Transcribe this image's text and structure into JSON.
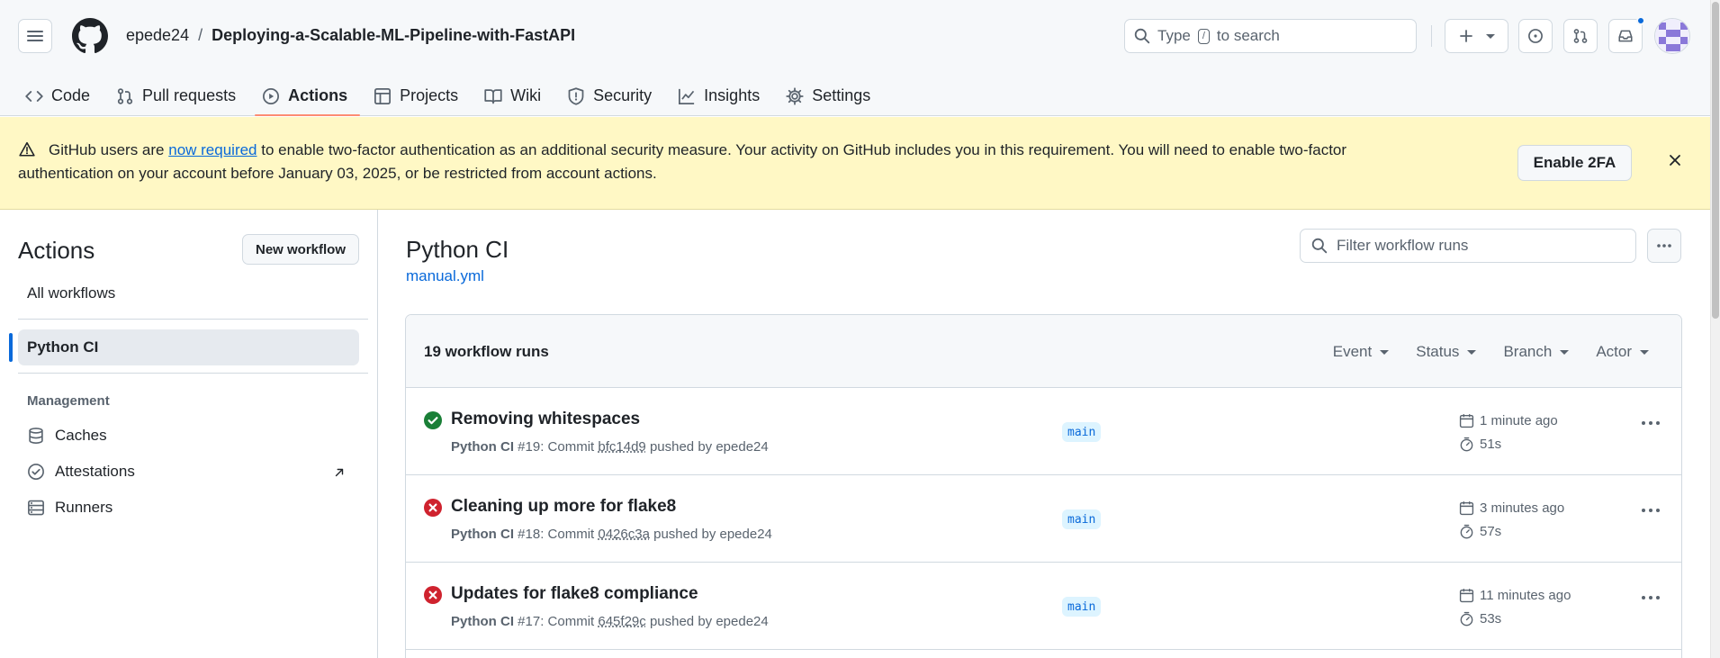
{
  "header": {
    "repo_owner": "epede24",
    "separator": "/",
    "repo_name": "Deploying-a-Scalable-ML-Pipeline-with-FastAPI",
    "search_prefix": "Type",
    "search_key": "/",
    "search_suffix": "to search"
  },
  "nav": {
    "code": "Code",
    "pull_requests": "Pull requests",
    "actions": "Actions",
    "projects": "Projects",
    "wiki": "Wiki",
    "security": "Security",
    "insights": "Insights",
    "settings": "Settings"
  },
  "banner": {
    "text_before_link": "GitHub users are ",
    "link": "now required",
    "text_after_link": " to enable two-factor authentication as an additional security measure. Your activity on GitHub includes you in this requirement. You will need to enable two-factor authentication on your account before January 03, 2025, or be restricted from account actions.",
    "button": "Enable 2FA"
  },
  "sidebar": {
    "title": "Actions",
    "new_workflow": "New workflow",
    "all_workflows": "All workflows",
    "active_workflow": "Python CI",
    "management_heading": "Management",
    "caches": "Caches",
    "attestations": "Attestations",
    "runners": "Runners"
  },
  "main": {
    "title": "Python CI",
    "file": "manual.yml",
    "filter_placeholder": "Filter workflow runs",
    "runs_count": "19 workflow runs",
    "filters": [
      "Event",
      "Status",
      "Branch",
      "Actor"
    ]
  },
  "runs": [
    {
      "title": "Removing whitespaces",
      "status": "success",
      "workflow": "Python CI",
      "number_text": "#19: Commit",
      "sha": "bfc14d9",
      "pushed_by": "pushed by epede24",
      "branch": "main",
      "time": "1 minute ago",
      "duration": "51s"
    },
    {
      "title": "Cleaning up more for flake8",
      "status": "failure",
      "workflow": "Python CI",
      "number_text": "#18: Commit",
      "sha": "0426c3a",
      "pushed_by": "pushed by epede24",
      "branch": "main",
      "time": "3 minutes ago",
      "duration": "57s"
    },
    {
      "title": "Updates for flake8 compliance",
      "status": "failure",
      "workflow": "Python CI",
      "number_text": "#17: Commit",
      "sha": "645f29c",
      "pushed_by": "pushed by epede24",
      "branch": "main",
      "time": "11 minutes ago",
      "duration": "53s"
    }
  ],
  "colors": {
    "accent": "#0969da",
    "success": "#1a7f37",
    "failure": "#cf222e",
    "tab_underline": "#fd8c73",
    "banner_bg": "#fff8c5"
  }
}
